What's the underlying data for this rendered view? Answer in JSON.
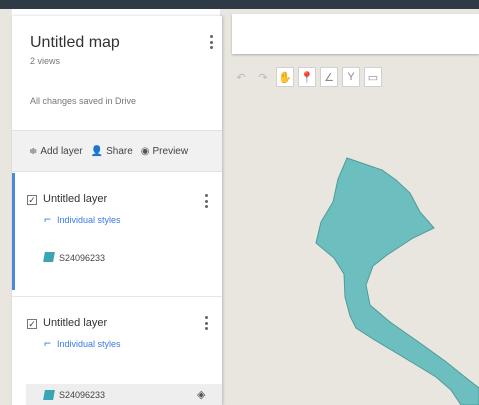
{
  "header": {
    "title": "Untitled map",
    "views": "2 views",
    "save_status": "All changes saved in Drive"
  },
  "actions": [
    {
      "icon": "add-layer-icon",
      "label": "Add layer"
    },
    {
      "icon": "share-icon",
      "label": "Share"
    },
    {
      "icon": "preview-icon",
      "label": "Preview"
    }
  ],
  "layers": [
    {
      "name": "Untitled layer",
      "checked": true,
      "style_label": "Individual styles",
      "feature": "S24096233"
    },
    {
      "name": "Untitled layer",
      "checked": true,
      "style_label": "Individual styles",
      "feature": "S24096233"
    }
  ],
  "map_toolbar": [
    {
      "icon": "undo-icon"
    },
    {
      "icon": "redo-icon"
    },
    {
      "icon": "hand-icon"
    },
    {
      "icon": "marker-icon"
    },
    {
      "icon": "draw-line-icon"
    },
    {
      "icon": "directions-icon"
    },
    {
      "icon": "ruler-icon"
    }
  ],
  "colors": {
    "polygon_fill": "#6dbfbf",
    "polygon_stroke": "#4e9a9a",
    "map_background": "#e8e6df",
    "selected_layer_accent": "#4a89dc",
    "link_blue": "#3b78e7"
  }
}
